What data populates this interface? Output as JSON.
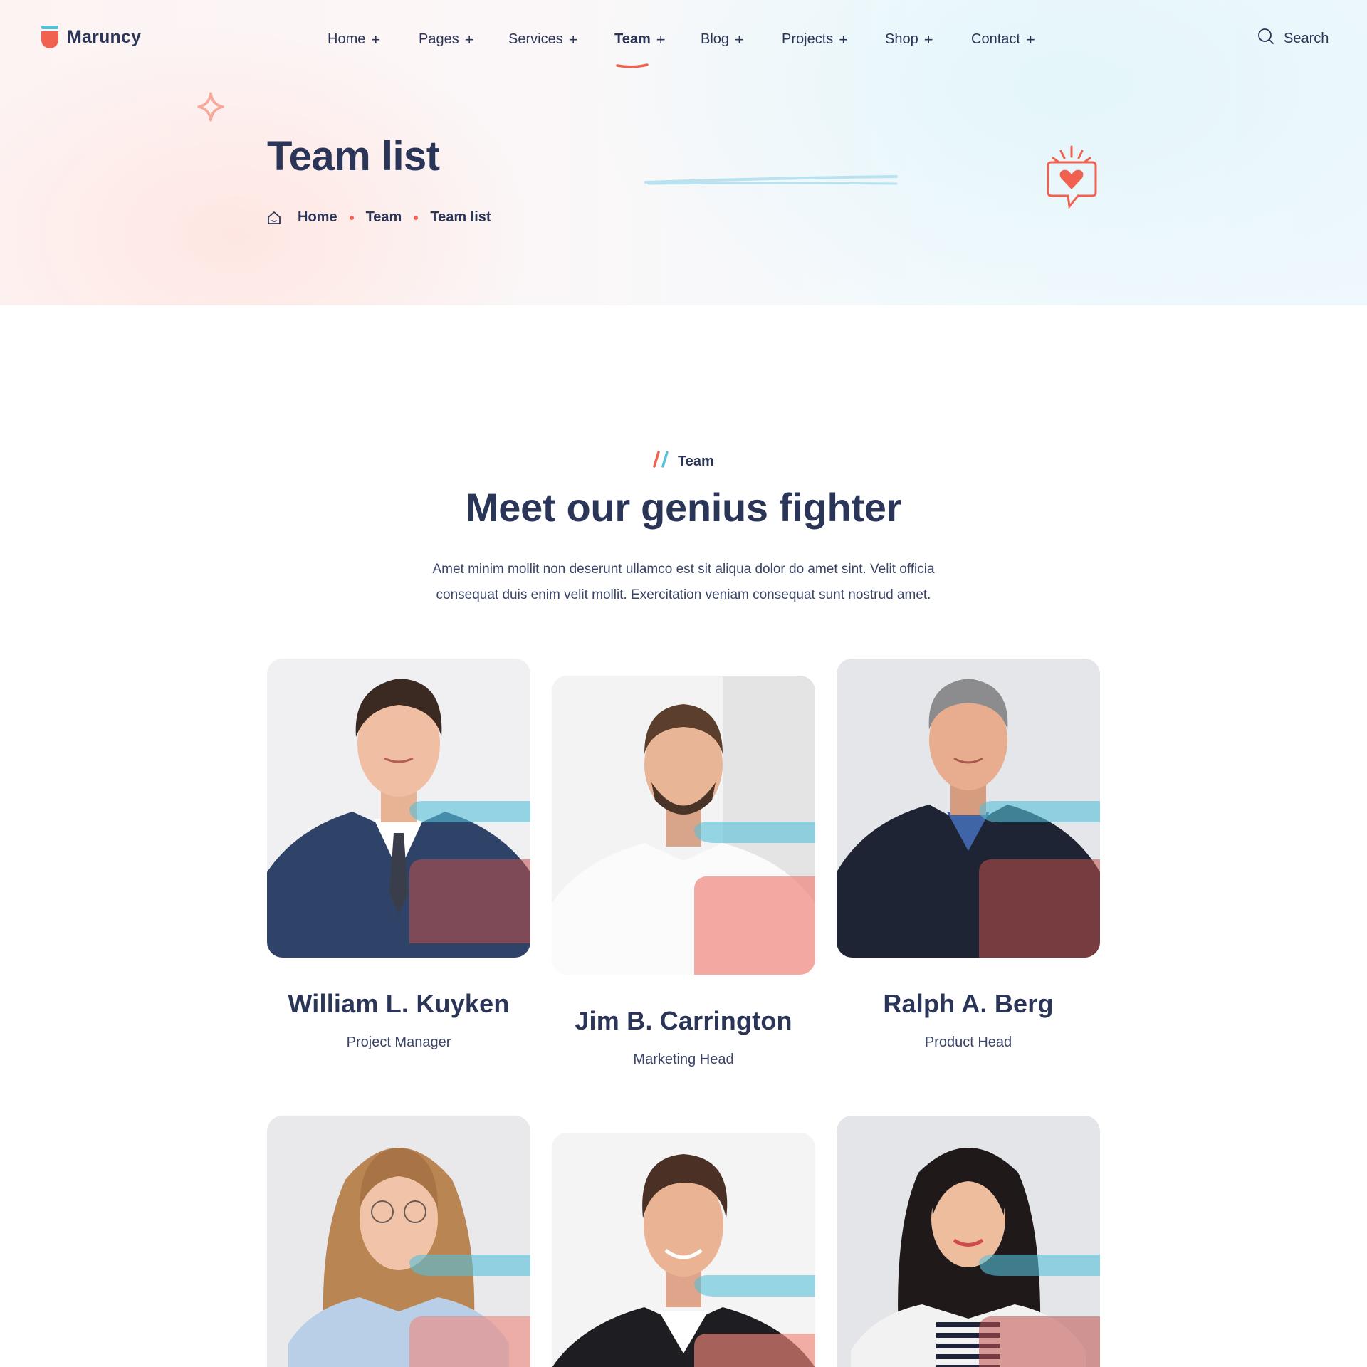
{
  "brand": {
    "name": "Maruncy",
    "accent": "#f0624f",
    "secondary": "#56c0d9",
    "text": "#2b3558"
  },
  "nav": {
    "items": [
      {
        "label": "Home",
        "plus": "+"
      },
      {
        "label": "Pages",
        "plus": "+"
      },
      {
        "label": "Services",
        "plus": "+"
      },
      {
        "label": "Team",
        "plus": "+",
        "active": true
      },
      {
        "label": "Blog",
        "plus": "+"
      },
      {
        "label": "Projects",
        "plus": "+"
      },
      {
        "label": "Shop",
        "plus": "+"
      },
      {
        "label": "Contact",
        "plus": "+"
      }
    ],
    "search_label": "Search",
    "search_icon": "search-icon"
  },
  "hero": {
    "title": "Team list",
    "breadcrumb": [
      "Home",
      "Team",
      "Team list"
    ],
    "home_icon": "home-icon"
  },
  "section": {
    "tag": "Team",
    "title": "Meet our genius fighter",
    "description_line1": "Amet minim mollit non deserunt ullamco est sit aliqua dolor do amet sint. Velit officia",
    "description_line2": "consequat duis enim velit mollit. Exercitation veniam consequat sunt nostrud amet."
  },
  "team": [
    {
      "name": "William L. Kuyken",
      "role": "Project Manager"
    },
    {
      "name": "Jim B. Carrington",
      "role": "Marketing Head"
    },
    {
      "name": "Ralph A. Berg",
      "role": "Product Head"
    },
    {
      "name": "",
      "role": ""
    },
    {
      "name": "",
      "role": ""
    },
    {
      "name": "",
      "role": ""
    }
  ]
}
